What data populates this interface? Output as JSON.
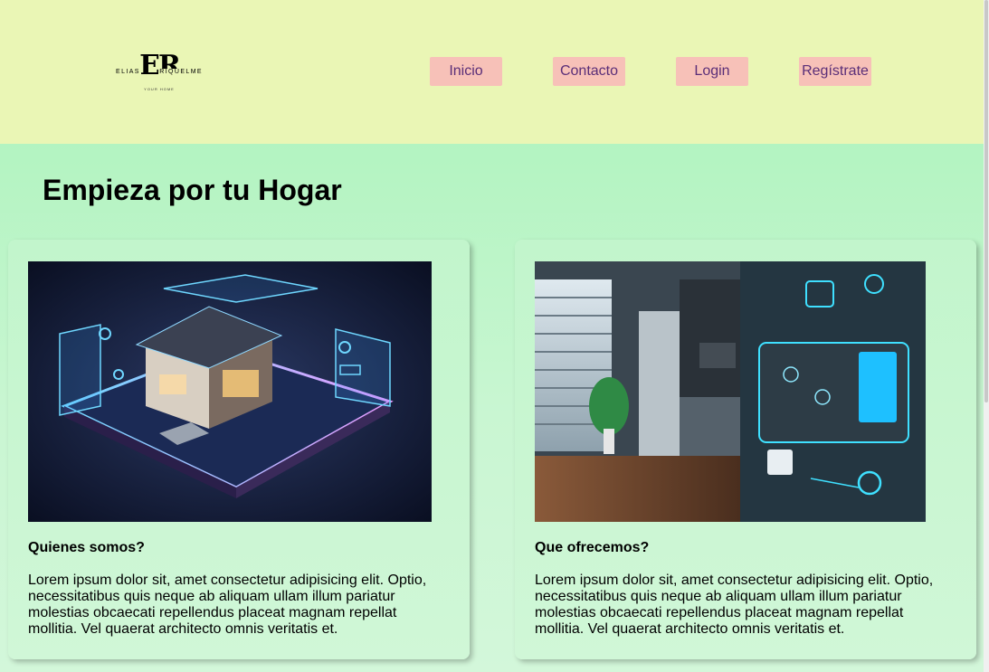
{
  "logo": {
    "mark": "ER",
    "name_left": "ELIAS",
    "name_right": "RIQUELME",
    "tagline": "YOUR HOME"
  },
  "nav": {
    "items": [
      "Inicio",
      "Contacto",
      "Login",
      "Regístrate"
    ]
  },
  "main": {
    "heading": "Empieza por tu Hogar",
    "cards": [
      {
        "title": "Quienes somos?",
        "text": "Lorem ipsum dolor sit, amet consectetur adipisicing elit. Optio, necessitatibus quis neque ab aliquam ullam illum pariatur molestias obcaecati repellendus placeat magnam repellat mollitia. Vel quaerat architecto omnis veritatis et.",
        "image": "smart-house-hologram-image"
      },
      {
        "title": "Que ofrecemos?",
        "text": "Lorem ipsum dolor sit, amet consectetur adipisicing elit. Optio, necessitatibus quis neque ab aliquam ullam illum pariatur molestias obcaecati repellendus placeat magnam repellat mollitia. Vel quaerat architecto omnis veritatis et.",
        "image": "smart-kitchen-control-panel-image"
      }
    ]
  },
  "colors": {
    "header_bg": "#eaf6b5",
    "main_bg": "#b3f4c1",
    "nav_button_bg": "#f7c1b8",
    "nav_button_text": "#5a2e78"
  }
}
